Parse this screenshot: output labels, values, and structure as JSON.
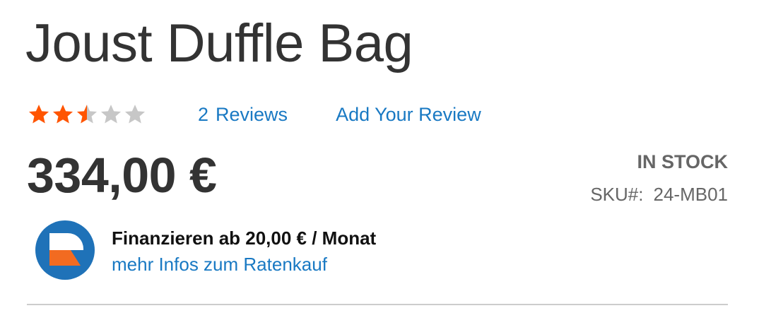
{
  "product": {
    "title": "Joust Duffle Bag",
    "price": "334,00 €",
    "stock_status": "IN STOCK",
    "sku_label": "SKU#:",
    "sku_value": "24-MB01"
  },
  "rating": {
    "value": 2.5,
    "max": 5,
    "filled_color": "#ff5501",
    "empty_color": "#c7c7c7",
    "reviews_count": "2",
    "reviews_label": "Reviews",
    "add_review_label": "Add Your Review"
  },
  "financing": {
    "title": "Finanzieren ab 20,00 € / Monat",
    "link_label": "mehr Infos zum Ratenkauf",
    "logo_colors": {
      "primary": "#1f72b8",
      "accent": "#f26b21"
    }
  },
  "colors": {
    "link": "#1979c3",
    "text": "#333333",
    "muted": "#666666"
  }
}
